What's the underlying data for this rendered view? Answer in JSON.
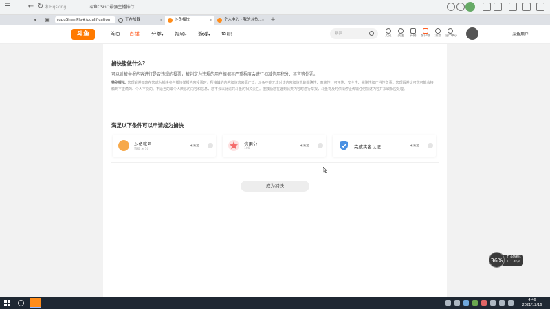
{
  "browser": {
    "search_placeholder": "和Fiqsking",
    "bookmark_text": "斗鱼CSGO最强主播排行...",
    "nav": {
      "back": "←",
      "refresh": "↻"
    },
    "window_controls": [
      "—",
      "☐",
      "✕"
    ]
  },
  "tabs": [
    {
      "label": "rupuShenlPl\\r#/qualification",
      "close": "",
      "is_address": true
    },
    {
      "label": "正在加载",
      "close": "×"
    },
    {
      "label": "斗鱼捕快",
      "close": "×",
      "active": true
    },
    {
      "label": "个人中心 - 我的斗鱼...",
      "close": "×"
    }
  ],
  "new_tab": "+",
  "site": {
    "logo_text": "斗鱼",
    "nav": [
      "首页",
      "直播",
      "分类",
      "视频",
      "游戏",
      "鱼吧"
    ],
    "nav_arrows": [
      "",
      "",
      "▾",
      "▾",
      "▾",
      ""
    ],
    "search_placeholder": "暴猫",
    "header_icons": [
      {
        "label": "历史",
        "icon": "history-icon"
      },
      {
        "label": "关注",
        "icon": "follow-icon"
      },
      {
        "label": "开播",
        "icon": "broadcast-icon"
      },
      {
        "label": "客户端",
        "icon": "client-icon"
      },
      {
        "label": "消息",
        "icon": "message-icon"
      },
      {
        "label": "设计中心",
        "icon": "location-icon"
      }
    ],
    "user_name": "斗鱼用户"
  },
  "main": {
    "title": "捕快能做什么?",
    "description": "可以对被举报内容进行是否违规的投票，被判定为违规的用户根据其严重程度会进行扣减信用积分、禁言等处罚。",
    "tip_label": "特别提示:",
    "tip_text": "您理解并知晓在您成为捕快参与捕快举报内容投票时，所接触的内容和信息来源广泛，斗鱼不能无法对该内容和信息的准确性、真实性、可用性、安全性、完整性和正当性负责。您理解并认可您可能会接触到不正确的、令人不快的、不适当的或令人厌恶的内容和信息，您不会以此追究斗鱼的相关责任。但鼓励您在遇到此类内容时进行举报，斗鱼将及时依法停止传输任何前述内容并采取相应处理。",
    "conditions_title": "满足以下条件可以申请成为捕快",
    "conditions": [
      {
        "name": "斗鱼账号",
        "sub": "等级 ≥ 10",
        "status": "未满足",
        "icon": "user-icon",
        "color": "#f7a94a"
      },
      {
        "name": "信用分",
        "sub": "100",
        "status": "未满足",
        "icon": "star-icon",
        "color": "#f56c6c"
      },
      {
        "name": "完成实名认证",
        "sub": "",
        "status": "未满足",
        "icon": "verified-shield-icon",
        "color": "#4a90e2"
      }
    ],
    "apply_button": "成为捕快"
  },
  "speed_widget": {
    "percent": "36%",
    "up": "↑ 449K/s",
    "down": "↓ 1.4K/s"
  },
  "taskbar": {
    "time": "4:46",
    "date": "2021/12/16"
  }
}
